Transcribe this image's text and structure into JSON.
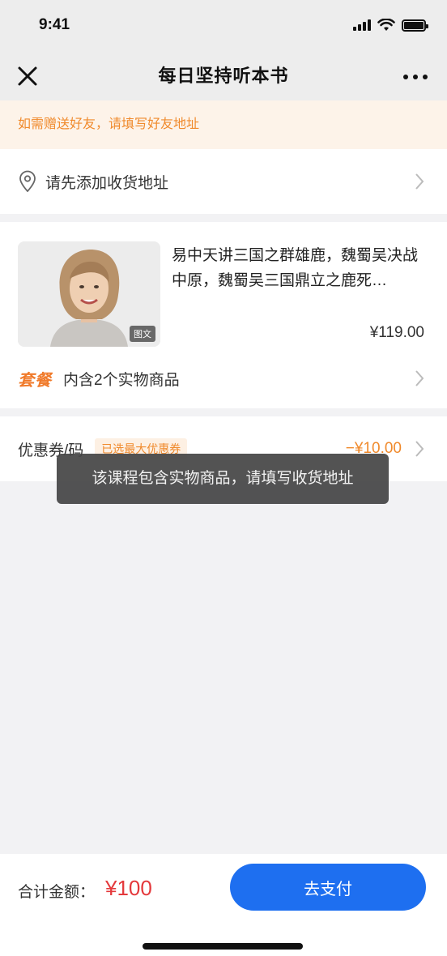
{
  "status": {
    "time": "9:41"
  },
  "nav": {
    "title": "每日坚持听本书"
  },
  "notice": {
    "text": "如需赠送好友，请填写好友地址"
  },
  "address": {
    "label": "请先添加收货地址"
  },
  "product": {
    "title": "易中天讲三国之群雄鹿，魏蜀吴决战中原，魏蜀吴三国鼎立之鹿死…",
    "price": "¥119.00",
    "thumb_tag": "图文",
    "bundle_badge": "套餐",
    "bundle_text": "内含2个实物商品"
  },
  "coupon": {
    "label": "优惠券/码",
    "tag": "已选最大优惠券",
    "value": "−¥10.00"
  },
  "toast": {
    "text": "该课程包含实物商品，请填写收货地址"
  },
  "footer": {
    "total_label": "合计金额：",
    "total_amount": "¥100",
    "pay_label": "去支付"
  },
  "colors": {
    "accent": "#1e6ff0",
    "warning": "#f08a2c",
    "price": "#e4393c"
  }
}
